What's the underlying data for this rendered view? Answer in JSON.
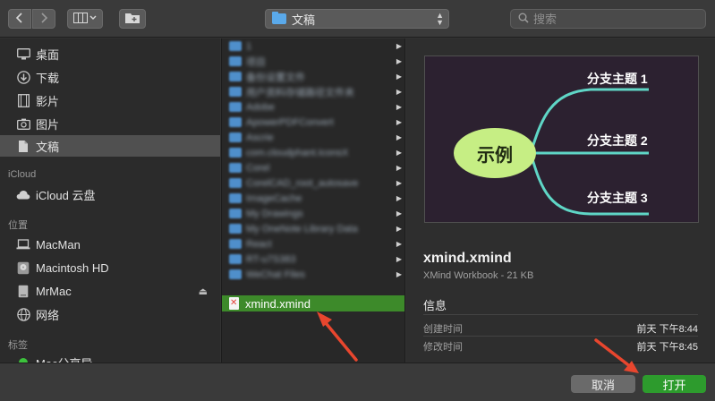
{
  "toolbar": {
    "back_icon": "chevron-left",
    "forward_icon": "chevron-right",
    "view_icon": "column-view",
    "new_folder_icon": "new-folder",
    "path_label": "文稿",
    "search_placeholder": "搜索"
  },
  "sidebar": {
    "favorites": [
      {
        "label": "桌面",
        "icon": "desktop-icon"
      },
      {
        "label": "下载",
        "icon": "download-icon"
      },
      {
        "label": "影片",
        "icon": "movies-icon"
      },
      {
        "label": "图片",
        "icon": "pictures-icon"
      },
      {
        "label": "文稿",
        "icon": "documents-icon",
        "selected": true
      }
    ],
    "icloud_heading": "iCloud",
    "icloud_items": [
      {
        "label": "iCloud 云盘",
        "icon": "cloud-icon"
      }
    ],
    "locations_heading": "位置",
    "locations": [
      {
        "label": "MacMan",
        "icon": "laptop-icon"
      },
      {
        "label": "Macintosh HD",
        "icon": "disk-icon"
      },
      {
        "label": "MrMac",
        "icon": "disk-icon",
        "eject": true
      },
      {
        "label": "网络",
        "icon": "network-icon"
      }
    ],
    "tags_heading": "标签",
    "tags": [
      {
        "label": "Mac分享导",
        "color": "#3cc23c"
      }
    ]
  },
  "file_column": {
    "items": [
      "1",
      "项目",
      "备份设置文件",
      "用户资料存储路径文件夹",
      "Adobe",
      "ApowerPDFConvert",
      "Ascrie",
      "com.cloudphant.IconsX",
      "Corel",
      "CorelCAD_root_autosave",
      "ImageCache",
      "My Drawings",
      "My OneNote Library Data",
      "React",
      "RT-u7S383",
      "WeChat Files"
    ],
    "selected_file": "xmind.xmind"
  },
  "preview": {
    "thumbnail": {
      "center_label": "示例",
      "branches": [
        "分支主题 1",
        "分支主题 2",
        "分支主题 3"
      ]
    },
    "filename": "xmind.xmind",
    "kind": "XMind Workbook - 21 KB",
    "info_label": "信息",
    "rows": [
      {
        "key": "创建时间",
        "value": "前天 下午8:44"
      },
      {
        "key": "修改时间",
        "value": "前天 下午8:45"
      }
    ]
  },
  "footer": {
    "cancel_label": "取消",
    "open_label": "打开"
  },
  "colors": {
    "accent_selection": "#3d8a2a",
    "open_button": "#2d9b2d",
    "annotation_arrow": "#e8462e",
    "mindmap_branch": "#5fd6c6",
    "mindmap_center": "#c6ee84"
  }
}
